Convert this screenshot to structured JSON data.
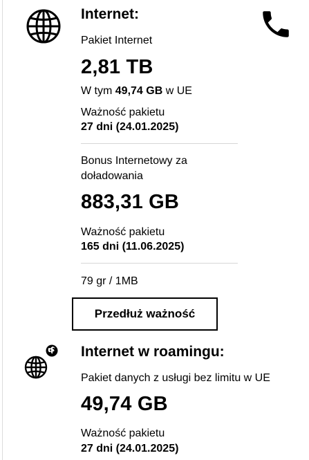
{
  "internet": {
    "title": "Internet:",
    "package": {
      "name": "Pakiet Internet",
      "amount": "2,81 TB",
      "eu_prefix": "W tym ",
      "eu_amount": "49,74 GB",
      "eu_suffix": " w UE",
      "validity_label": "Ważność pakietu",
      "validity_value": "27 dni (24.01.2025)"
    },
    "bonus": {
      "name_line1": "Bonus Internetowy za",
      "name_line2": "doładowania",
      "amount": "883,31 GB",
      "validity_label": "Ważność pakietu",
      "validity_value": "165 dni (11.06.2025)"
    },
    "rate": "79 gr / 1MB",
    "extend_button": "Przedłuż ważność"
  },
  "roaming": {
    "title": "Internet w roamingu:",
    "package": {
      "name": "Pakiet danych z usługi bez limitu w UE",
      "amount": "49,74 GB",
      "validity_label": "Ważność pakietu",
      "validity_value": "27 dni (24.01.2025)"
    }
  },
  "icons": [
    "globe-icon",
    "phone-icon",
    "roaming-globe-icon",
    "small-globe-icon"
  ]
}
